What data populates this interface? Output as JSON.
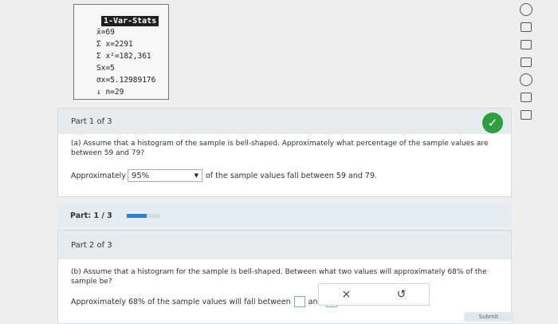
{
  "calc": {
    "title": "1-Var-Stats",
    "lines": [
      "x̄=69",
      "Σ x=2291",
      "Σ x²=182,361",
      "Sx=5",
      "σx=5.12989176",
      "↓ n=29"
    ]
  },
  "part1": {
    "header": "Part 1 of 3",
    "question": "(a) Assume that a histogram of the sample is bell-shaped. Approximately what percentage of the sample values are between 59 and 79?",
    "answer_prefix": "Approximately",
    "dropdown_value": "95%",
    "answer_suffix": "of the sample values fall between 59 and 79."
  },
  "progress": {
    "label": "Part: 1 / 3",
    "fraction": 0.6
  },
  "part2": {
    "header": "Part 2 of 3",
    "question": "(b) Assume that a histogram for the sample is bell-shaped. Between what two values will approximately 68% of the sample be?",
    "answer_prefix": "Approximately 68% of the sample values will fall between",
    "answer_mid": "and"
  },
  "tools": {
    "clear_label": "×",
    "undo_label": "↺"
  },
  "submit_label": "Submit Assignment",
  "colors": {
    "check": "#2e9e3e",
    "progress": "#2f7fcc"
  }
}
